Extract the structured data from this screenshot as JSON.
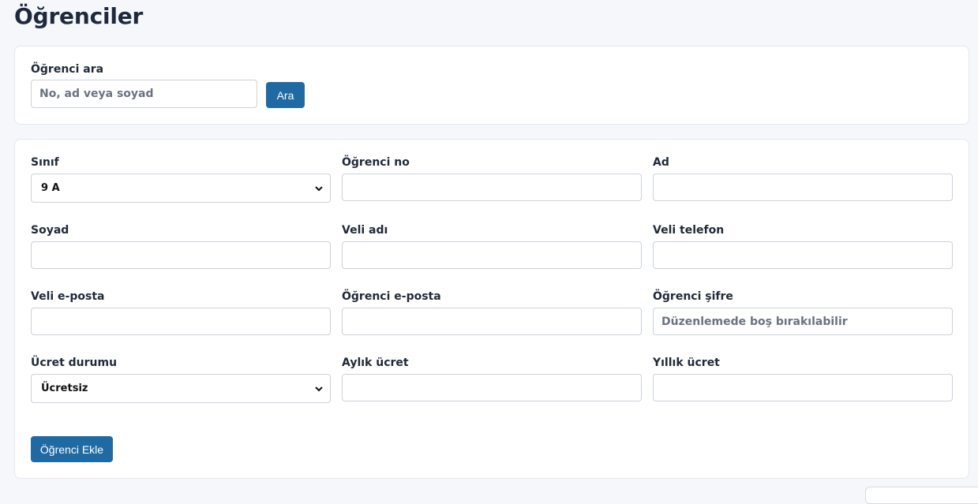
{
  "page": {
    "title": "Öğrenciler"
  },
  "search": {
    "label": "Öğrenci ara",
    "placeholder": "No, ad veya soyad",
    "button_label": "Ara"
  },
  "form": {
    "sinif": {
      "label": "Sınıf",
      "value": "9 A"
    },
    "ogrenci_no": {
      "label": "Öğrenci no",
      "value": ""
    },
    "ad": {
      "label": "Ad",
      "value": ""
    },
    "soyad": {
      "label": "Soyad",
      "value": ""
    },
    "veli_adi": {
      "label": "Veli adı",
      "value": ""
    },
    "veli_telefon": {
      "label": "Veli telefon",
      "value": ""
    },
    "veli_eposta": {
      "label": "Veli e-posta",
      "value": ""
    },
    "ogrenci_eposta": {
      "label": "Öğrenci e-posta",
      "value": ""
    },
    "ogrenci_sifre": {
      "label": "Öğrenci şifre",
      "value": "",
      "placeholder": "Düzenlemede boş bırakılabilir"
    },
    "ucret_durumu": {
      "label": "Ücret durumu",
      "value": "Ücretsiz"
    },
    "aylik_ucret": {
      "label": "Aylık ücret",
      "value": ""
    },
    "yillik_ucret": {
      "label": "Yıllık ücret",
      "value": ""
    },
    "submit_label": "Öğrenci Ekle"
  },
  "colors": {
    "primary": "#1f6aa3",
    "background": "#f5f7fb",
    "card_border": "#e3e7ee"
  },
  "icons": {
    "select_chevron": "chevron-down-icon"
  }
}
